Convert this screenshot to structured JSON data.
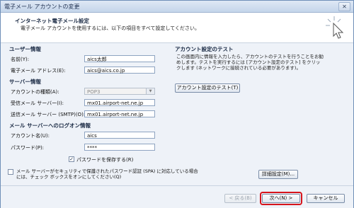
{
  "window": {
    "title": "電子メール アカウントの変更",
    "close_icon": "close-icon"
  },
  "header": {
    "title": "インターネット電子メール設定",
    "subtitle": "電子メール アカウントを使用するには、以下の項目をすべて設定してください。"
  },
  "user_info": {
    "section": "ユーザー情報",
    "name_label": "名前(Y):",
    "name_value": "aics太郎",
    "email_label": "電子メール アドレス(E):",
    "email_value": "aics@aics.co.jp"
  },
  "server_info": {
    "section": "サーバー情報",
    "account_type_label": "アカウントの種類(A):",
    "account_type_value": "POP3",
    "incoming_label": "受信メール サーバー(I):",
    "incoming_value": "mx01.airport-net.ne.jp",
    "outgoing_label": "送信メール サーバー (SMTP)(O):",
    "outgoing_value": "mx01.airport-net.ne.jp"
  },
  "logon_info": {
    "section": "メール サーバーへのログオン情報",
    "account_name_label": "アカウント名(U):",
    "account_name_value": "aics",
    "password_label": "パスワード(P):",
    "password_value": "****",
    "save_password_label": "パスワードを保存する(R)",
    "save_password_checked": true,
    "spa_label": "メール サーバーがセキュリティで保護されたパスワード認証 (SPA) に対応している場合には、チェック ボックスをオンにしてください(Q)",
    "spa_checked": false
  },
  "test": {
    "section": "アカウント設定のテスト",
    "description": "この画面内に情報を入力したら、アカウントのテストを行うことをお勧めします。テストを実行するには [アカウント設定のテスト] をクリックします (ネットワークに接続されている必要があります)。",
    "test_button": "アカウント設定のテスト(T)",
    "details_button": "詳細設定(M)..."
  },
  "footer": {
    "back_button": "< 戻る(B)",
    "next_button": "次へ(N) >",
    "cancel_button": "キャンセル"
  },
  "colors": {
    "highlight": "#d6141c",
    "accent": "#1a2a44"
  }
}
